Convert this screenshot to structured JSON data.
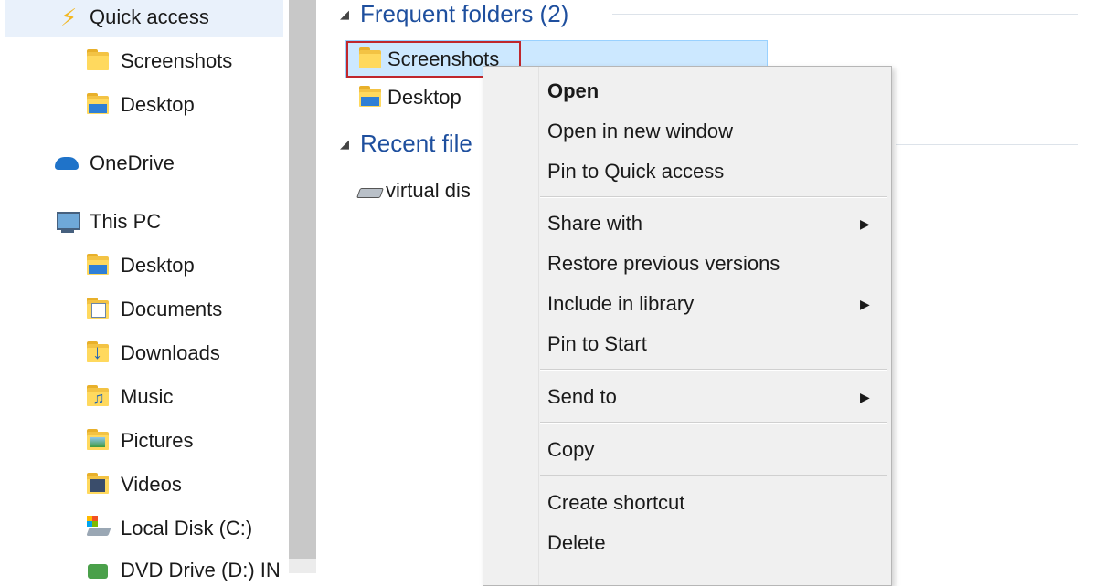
{
  "navigation": {
    "quick_access": "Quick access",
    "qa_items": [
      "Screenshots",
      "Desktop"
    ],
    "onedrive": "OneDrive",
    "this_pc": "This PC",
    "pc_items": [
      "Desktop",
      "Documents",
      "Downloads",
      "Music",
      "Pictures",
      "Videos",
      "Local Disk (C:)",
      "DVD Drive (D:) IN"
    ]
  },
  "content": {
    "frequent_header": "Frequent folders (2)",
    "frequent_items": [
      "Screenshots",
      "Desktop"
    ],
    "recent_header": "Recent file",
    "recent_items": [
      "virtual dis"
    ]
  },
  "context_menu": {
    "open": "Open",
    "open_new_window": "Open in new window",
    "pin_quick_access": "Pin to Quick access",
    "share_with": "Share with",
    "restore_previous": "Restore previous versions",
    "include_library": "Include in library",
    "pin_start": "Pin to Start",
    "send_to": "Send to",
    "copy": "Copy",
    "create_shortcut": "Create shortcut",
    "delete": "Delete"
  },
  "colors": {
    "selection": "#cce8ff",
    "focus_outline": "#c0272d",
    "group_header": "#1e4f9e"
  }
}
